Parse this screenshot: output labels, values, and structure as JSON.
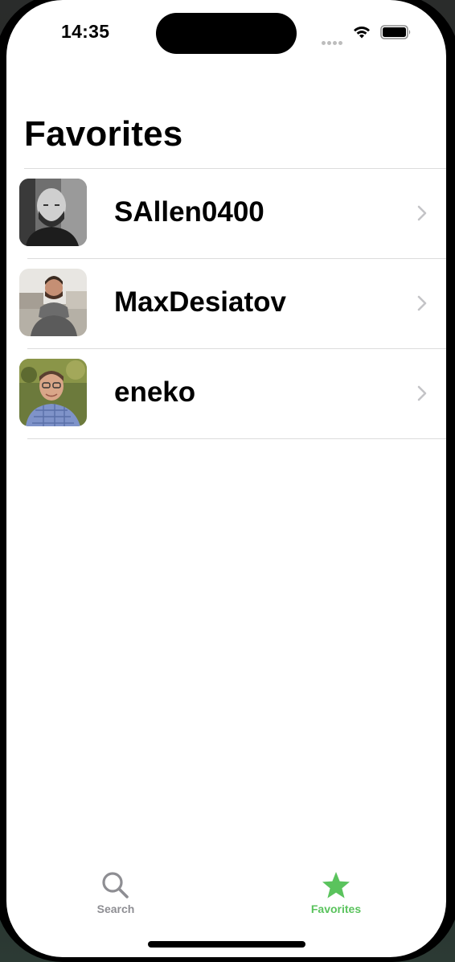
{
  "status_bar": {
    "time": "14:35",
    "icons": [
      "cellular-signal-icon",
      "wifi-icon",
      "battery-icon"
    ]
  },
  "header": {
    "title": "Favorites"
  },
  "favorites": [
    {
      "name": "SAllen0400",
      "avatar": "avatar-bald-man-bw"
    },
    {
      "name": "MaxDesiatov",
      "avatar": "avatar-man-scarf"
    },
    {
      "name": "eneko",
      "avatar": "avatar-man-glasses"
    }
  ],
  "tab_bar": {
    "items": [
      {
        "label": "Search",
        "icon": "magnifying-glass-icon",
        "selected": false
      },
      {
        "label": "Favorites",
        "icon": "star-icon",
        "selected": true
      }
    ],
    "accent_color": "#5ac35d",
    "inactive_color": "#8e8e93"
  }
}
